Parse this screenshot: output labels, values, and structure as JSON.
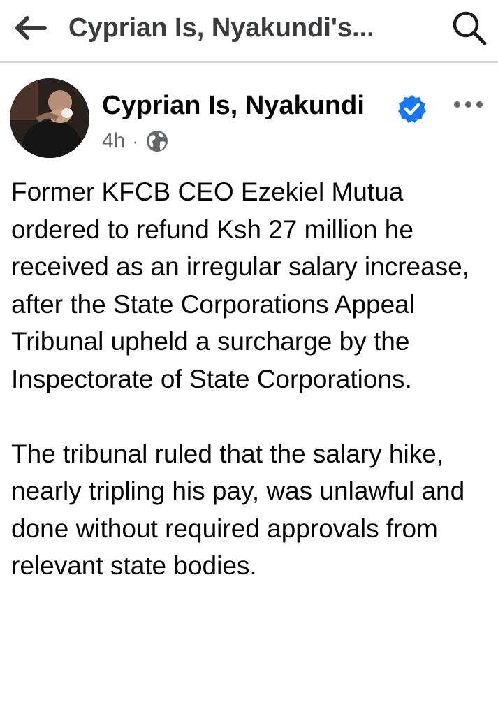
{
  "topbar": {
    "back_icon": "arrow-left-icon",
    "title": "Cyprian Is, Nyakundi's...",
    "search_icon": "search-icon"
  },
  "post": {
    "author_name": "Cyprian Is, Nyakundi",
    "verified_icon": "verified-badge-icon",
    "more_icon": "more-options-icon",
    "time": "4h",
    "separator": "·",
    "audience_icon": "globe-icon",
    "paragraphs": [
      "Former KFCB CEO Ezekiel Mutua ordered to refund Ksh 27 million he received as an irregular salary increase, after the State Corporations Appeal Tribunal upheld a surcharge by the Inspectorate of State Corporations.",
      "The tribunal ruled that the salary hike, nearly tripling his pay, was unlawful and done without required approvals from relevant state bodies."
    ]
  },
  "colors": {
    "text_primary": "#050505",
    "text_secondary": "#65676b",
    "verified_blue": "#1877f2",
    "divider": "#d6d6d6"
  }
}
